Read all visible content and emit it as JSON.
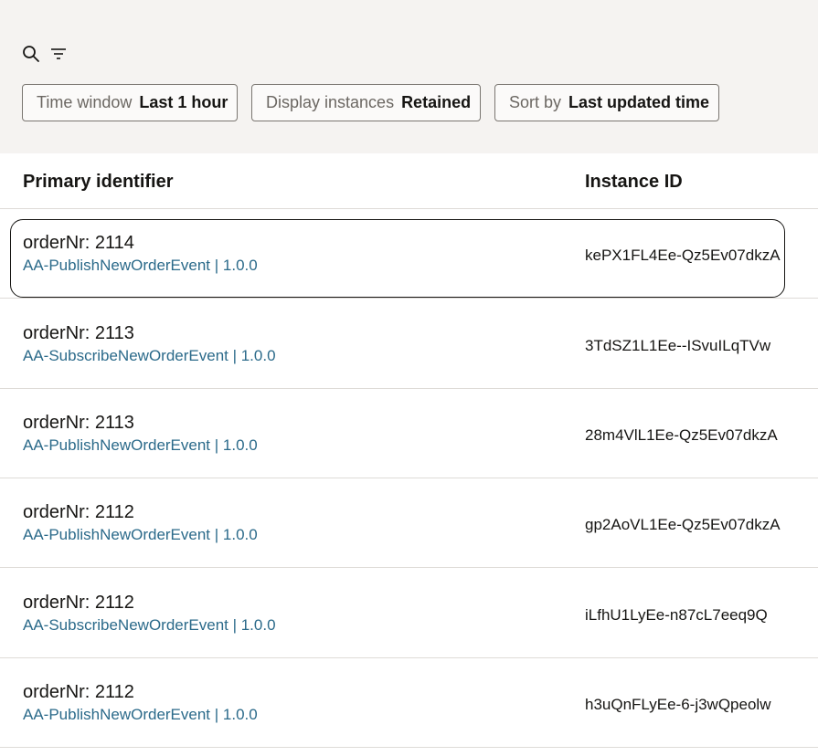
{
  "toolbar": {
    "search_icon": "search-icon",
    "filter_icon": "filter-icon",
    "chips": [
      {
        "label": "Time window",
        "value": "Last 1 hour"
      },
      {
        "label": "Display instances",
        "value": "Retained"
      },
      {
        "label": "Sort by",
        "value": "Last updated time"
      }
    ]
  },
  "table": {
    "headers": {
      "primary": "Primary identifier",
      "instance": "Instance ID"
    },
    "rows": [
      {
        "primary": "orderNr: 2114",
        "sub": "AA-PublishNewOrderEvent | 1.0.0",
        "instance": "kePX1FL4Ee-Qz5Ev07dkzA"
      },
      {
        "primary": "orderNr: 2113",
        "sub": "AA-SubscribeNewOrderEvent | 1.0.0",
        "instance": "3TdSZ1L1Ee--ISvuILqTVw"
      },
      {
        "primary": "orderNr: 2113",
        "sub": "AA-PublishNewOrderEvent | 1.0.0",
        "instance": "28m4VlL1Ee-Qz5Ev07dkzA"
      },
      {
        "primary": "orderNr: 2112",
        "sub": "AA-PublishNewOrderEvent | 1.0.0",
        "instance": "gp2AoVL1Ee-Qz5Ev07dkzA"
      },
      {
        "primary": "orderNr: 2112",
        "sub": "AA-SubscribeNewOrderEvent | 1.0.0",
        "instance": "iLfhU1LyEe-n87cL7eeq9Q"
      },
      {
        "primary": "orderNr: 2112",
        "sub": "AA-PublishNewOrderEvent | 1.0.0",
        "instance": "h3uQnFLyEe-6-j3wQpeolw"
      }
    ]
  },
  "colors": {
    "toolbar_bg": "#f5f3f1",
    "link": "#2b6a8a",
    "divider": "#dedbd7"
  }
}
